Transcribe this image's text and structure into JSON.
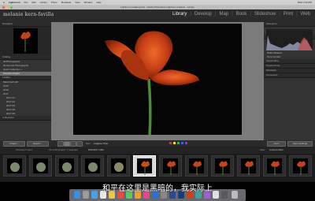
{
  "menubar": {
    "app": "Lightroom",
    "items": [
      "File",
      "Edit",
      "Library",
      "Photo",
      "Metadata",
      "View",
      "Window",
      "Help"
    ],
    "clock": "Wed 3:44 PM"
  },
  "window": {
    "title": "Lightroom Catalog.lrcat - Adobe Photoshop Lightroom Classic - Library"
  },
  "identity": {
    "brand": "melanie kern-favilla"
  },
  "modules": [
    "Library",
    "Develop",
    "Map",
    "Book",
    "Slideshow",
    "Print",
    "Web"
  ],
  "left_panel": {
    "navigator": "Navigator",
    "catalog": "Catalog",
    "catalog_items": [
      "All Photographs",
      "All Synced Photographs",
      "Quick Collection +",
      "Previous Import"
    ],
    "folders": "Folders",
    "folder_items": [
      "Macintosh HD",
      "2015",
      "2016",
      "2017",
      "2017-01",
      "2017-02",
      "2017-03",
      "2017-04",
      "2017-05"
    ],
    "collections": "Collections",
    "import_label": "Import...",
    "export_label": "Export..."
  },
  "right_panel": {
    "histogram": "Histogram",
    "quick_develop": "Quick Develop",
    "rows": [
      "Original Photo",
      "Saved Preset",
      "Custom",
      "White Balance",
      "Tone Control",
      "Keywording",
      "Keyword List",
      "Metadata",
      "Comments"
    ],
    "sync_label": "Sync",
    "sync_settings_label": "Sync Settings"
  },
  "toolbar": {
    "sort_label": "Sort:",
    "sort_value": "Capture Time"
  },
  "filmstrip_bar": {
    "source": "Previous Import",
    "count": "19 of 96 photos / 1 selected",
    "file": "DSC0017.CR2",
    "filter_label": "Filter:",
    "filter_value": "Custom Filter"
  },
  "subtitle": "和平在这里是黑暗的，我实际上"
}
